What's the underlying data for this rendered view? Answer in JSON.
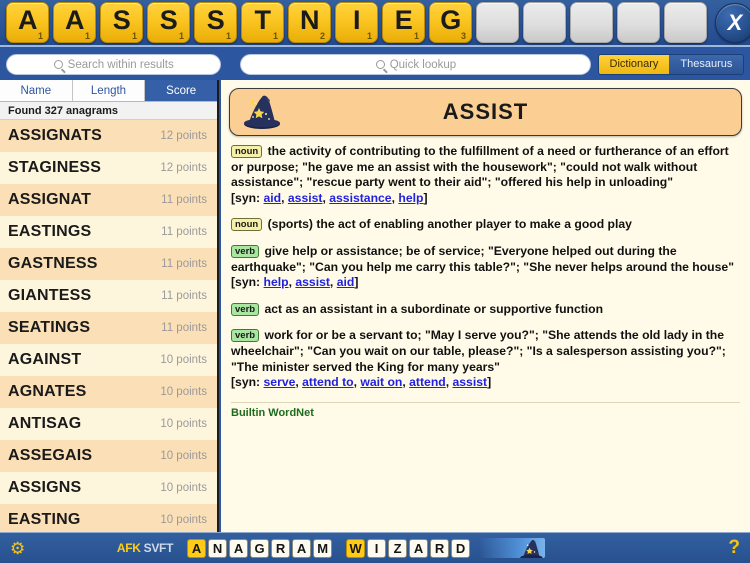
{
  "rack": {
    "tiles": [
      {
        "letter": "A",
        "points": "1"
      },
      {
        "letter": "A",
        "points": "1"
      },
      {
        "letter": "S",
        "points": "1"
      },
      {
        "letter": "S",
        "points": "1"
      },
      {
        "letter": "S",
        "points": "1"
      },
      {
        "letter": "T",
        "points": "1"
      },
      {
        "letter": "N",
        "points": "2"
      },
      {
        "letter": "I",
        "points": "1"
      },
      {
        "letter": "E",
        "points": "1"
      },
      {
        "letter": "G",
        "points": "3"
      }
    ],
    "empty_slots": 5,
    "clear_label": "X"
  },
  "search": {
    "within_placeholder": "Search within results",
    "within_value": "",
    "quick_placeholder": "Quick lookup",
    "quick_value": "",
    "dictionary_label": "Dictionary",
    "thesaurus_label": "Thesaurus",
    "active_source": "Dictionary"
  },
  "results": {
    "sort_tabs": [
      {
        "label": "Name",
        "active": false
      },
      {
        "label": "Length",
        "active": false
      },
      {
        "label": "Score",
        "active": true
      }
    ],
    "found_text": "Found 327 anagrams",
    "count": 327,
    "rows": [
      {
        "word": "ASSIGNATS",
        "points": "12 points"
      },
      {
        "word": "STAGINESS",
        "points": "12 points"
      },
      {
        "word": "ASSIGNAT",
        "points": "11 points"
      },
      {
        "word": "EASTINGS",
        "points": "11 points"
      },
      {
        "word": "GASTNESS",
        "points": "11 points"
      },
      {
        "word": "GIANTESS",
        "points": "11 points"
      },
      {
        "word": "SEATINGS",
        "points": "11 points"
      },
      {
        "word": "AGAINST",
        "points": "10 points"
      },
      {
        "word": "AGNATES",
        "points": "10 points"
      },
      {
        "word": "ANTISAG",
        "points": "10 points"
      },
      {
        "word": "ASSEGAIS",
        "points": "10 points"
      },
      {
        "word": "ASSIGNS",
        "points": "10 points"
      },
      {
        "word": "EASTING",
        "points": "10 points"
      }
    ]
  },
  "entry": {
    "headword": "ASSIST",
    "hat_icon": "wizard-hat-icon",
    "senses": [
      {
        "pos": "noun",
        "text": "the activity of contributing to the fulfillment of a need or furtherance of an effort or purpose; \"he gave me an assist with the housework\"; \"could not walk without assistance\"; \"rescue party went to their aid\"; \"offered his help in unloading\"",
        "syn_prefix": "[syn: ",
        "syn_suffix": "]",
        "synonyms": [
          "aid",
          "assist",
          "assistance",
          "help"
        ]
      },
      {
        "pos": "noun",
        "text": "(sports) the act of enabling another player to make a good play",
        "syn_prefix": "",
        "syn_suffix": "",
        "synonyms": []
      },
      {
        "pos": "verb",
        "text": "give help or assistance; be of service; \"Everyone helped out during the earthquake\"; \"Can you help me carry this table?\"; \"She never helps around the house\"",
        "syn_prefix": "[syn: ",
        "syn_suffix": "]",
        "synonyms": [
          "help",
          "assist",
          "aid"
        ]
      },
      {
        "pos": "verb",
        "text": "act as an assistant in a subordinate or supportive function",
        "syn_prefix": "",
        "syn_suffix": "",
        "synonyms": []
      },
      {
        "pos": "verb",
        "text": "work for or be a servant to; \"May I serve you?\"; \"She attends the old lady in the wheelchair\"; \"Can you wait on our table, please?\"; \"Is a salesperson assisting you?\"; \"The minister served the King for many years\"",
        "syn_prefix": "[syn: ",
        "syn_suffix": "]",
        "synonyms": [
          "serve",
          "attend to",
          "wait on",
          "attend",
          "assist"
        ]
      }
    ],
    "source_note": "Builtin WordNet"
  },
  "footer": {
    "settings_icon": "gear-icon",
    "help_icon": "question-mark-icon",
    "brand_afk": "AFK",
    "brand_svft": "SVFT",
    "word1": "ANAGRAM",
    "word2": "WIZARD",
    "hat_icon": "wizard-hat-icon"
  },
  "colors": {
    "chrome_blue": "#2c56a0",
    "tile_yellow": "#fbc521",
    "paper": "#fffbe8",
    "row_odd": "#fbdfb7",
    "row_even": "#fdf6dd",
    "head_peach": "#fbcf93",
    "link_blue": "#2222dd",
    "accent_gold": "#f5c415"
  }
}
